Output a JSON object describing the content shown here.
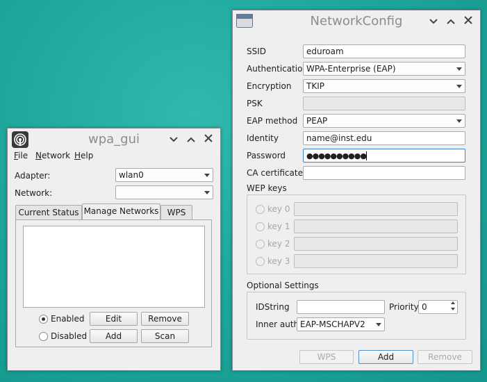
{
  "wpa_gui": {
    "title": "wpa_gui",
    "menu": [
      {
        "label": "File",
        "mnemonic": "F",
        "rest": "ile"
      },
      {
        "label": "Network",
        "mnemonic": "N",
        "rest": "etwork"
      },
      {
        "label": "Help",
        "mnemonic": "H",
        "rest": "elp"
      }
    ],
    "adapter_label": "Adapter:",
    "adapter_value": "wlan0",
    "network_label": "Network:",
    "network_value": "",
    "tabs": [
      "Current Status",
      "Manage Networks",
      "WPS"
    ],
    "active_tab": "Manage Networks",
    "radio_enabled": "Enabled",
    "radio_disabled": "Disabled",
    "buttons": {
      "edit": "Edit",
      "remove": "Remove",
      "add": "Add",
      "scan": "Scan"
    }
  },
  "network_config": {
    "title": "NetworkConfig",
    "ssid_label": "SSID",
    "ssid_value": "eduroam",
    "auth_label": "Authentication",
    "auth_value": "WPA-Enterprise (EAP)",
    "enc_label": "Encryption",
    "enc_value": "TKIP",
    "psk_label": "PSK",
    "psk_value": "",
    "eap_label": "EAP method",
    "eap_value": "PEAP",
    "identity_label": "Identity",
    "identity_value": "name@inst.edu",
    "password_label": "Password",
    "password_value": "●●●●●●●●●●",
    "ca_label": "CA certificate",
    "ca_value": "",
    "wep_label": "WEP keys",
    "wep_keys": [
      "key 0",
      "key 1",
      "key 2",
      "key 3"
    ],
    "optional_label": "Optional Settings",
    "idstring_label": "IDString",
    "idstring_value": "",
    "priority_label": "Priority",
    "priority_value": "0",
    "inner_auth_label": "Inner auth",
    "inner_auth_value": "EAP-MSCHAPV2",
    "buttons": {
      "wps": "WPS",
      "add": "Add",
      "remove": "Remove"
    }
  },
  "icons": {
    "minimize": "chevron-down-icon",
    "maximize": "chevron-up-icon",
    "close": "close-icon",
    "app": "wifi-signal-icon"
  },
  "colors": {
    "desktop": "#1fa79c",
    "window": "#efefef",
    "focus": "#3d82c4"
  }
}
